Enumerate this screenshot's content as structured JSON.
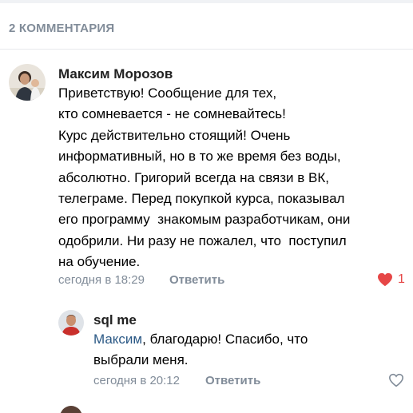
{
  "header": {
    "count_label": "2 КОММЕНТАРИЯ"
  },
  "comments": [
    {
      "author": "Максим Морозов",
      "text": "Приветствую! Сообщение для тех,\nкто сомневается - не сомневайтесь!\nКурс действительно стоящий! Очень\nинформативный, но в то же время без воды,\nабсолютно. Григорий всегда на связи в ВК,\nтелеграме. Перед покупкой курса, показывал\nего программу  знакомым разработчикам, они\nодобрили. Ни разу не пожалел, что  поступил\nна обучение.",
      "time": "сегодня в 18:29",
      "reply_label": "Ответить",
      "like_count": "1",
      "liked": true,
      "like_icon": "heart-filled-icon"
    },
    {
      "author": "sql me",
      "mention": "Максим",
      "text_rest": ", благодарю! Спасибо, что\nвыбрали меня.",
      "time": "сегодня в 20:12",
      "reply_label": "Ответить",
      "liked": false,
      "like_icon": "heart-outline-icon"
    }
  ],
  "colors": {
    "meta_gray": "#818c99",
    "mention_blue": "#2a5885",
    "like_red": "#e64646"
  }
}
